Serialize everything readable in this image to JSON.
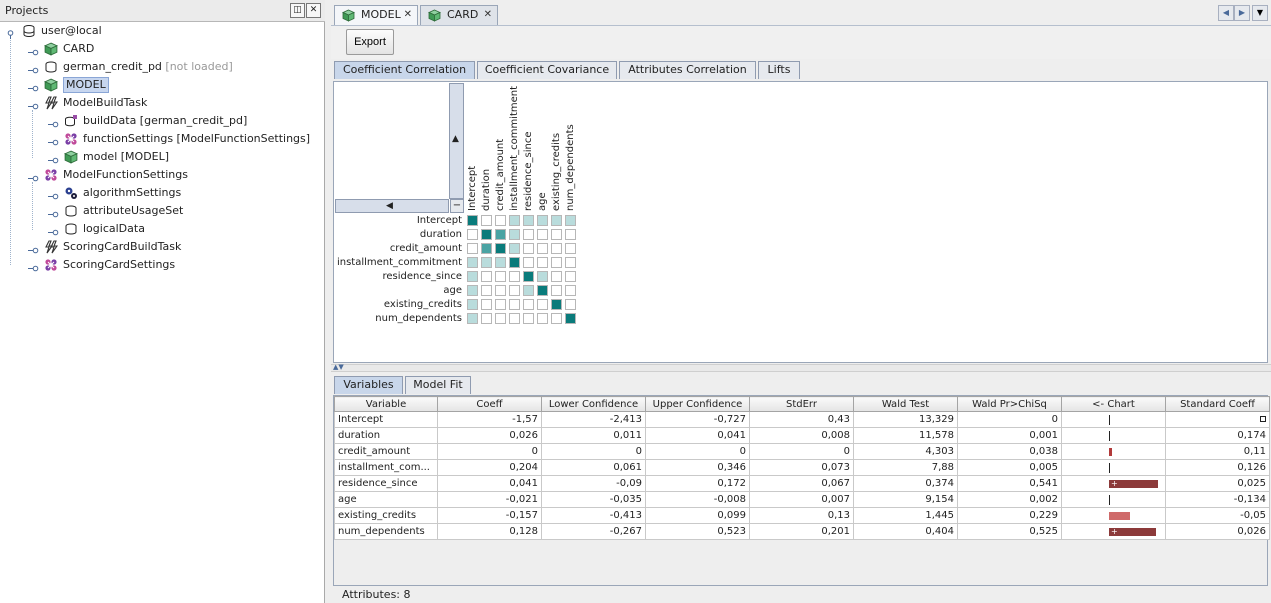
{
  "projects_panel": {
    "title": "Projects",
    "tree": [
      {
        "label": "user@local",
        "note": "",
        "icon": "database-icon",
        "level": 0
      },
      {
        "label": "CARD",
        "note": "",
        "icon": "model-cube-icon",
        "level": 1
      },
      {
        "label": "german_credit_pd",
        "note": "[not loaded]",
        "icon": "data-source-icon",
        "level": 1
      },
      {
        "label": "MODEL",
        "note": "",
        "icon": "model-cube-icon",
        "level": 1,
        "selected": true
      },
      {
        "label": "ModelBuildTask",
        "note": "",
        "icon": "build-task-icon",
        "level": 1
      },
      {
        "label": "buildData [german_credit_pd]",
        "note": "",
        "icon": "build-data-icon",
        "level": 2
      },
      {
        "label": "functionSettings [ModelFunctionSettings]",
        "note": "",
        "icon": "function-settings-icon",
        "level": 2
      },
      {
        "label": "model [MODEL]",
        "note": "",
        "icon": "model-cube-icon",
        "level": 2
      },
      {
        "label": "ModelFunctionSettings",
        "note": "",
        "icon": "function-settings-icon",
        "level": 1
      },
      {
        "label": "algorithmSettings",
        "note": "",
        "icon": "algorithm-gears-icon",
        "level": 2
      },
      {
        "label": "attributeUsageSet",
        "note": "",
        "icon": "attribute-set-icon",
        "level": 2
      },
      {
        "label": "logicalData",
        "note": "",
        "icon": "logical-data-icon",
        "level": 2
      },
      {
        "label": "ScoringCardBuildTask",
        "note": "",
        "icon": "build-task-icon",
        "level": 1
      },
      {
        "label": "ScoringCardSettings",
        "note": "",
        "icon": "function-settings-icon",
        "level": 1
      }
    ]
  },
  "doc_tabs": [
    {
      "label": "MODEL",
      "active": true
    },
    {
      "label": "CARD",
      "active": false
    }
  ],
  "toolbar": {
    "export_label": "Export"
  },
  "view_tabs": [
    {
      "label": "Coefficient Correlation",
      "active": true
    },
    {
      "label": "Coefficient Covariance",
      "active": false
    },
    {
      "label": "Attributes Correlation",
      "active": false
    },
    {
      "label": "Lifts",
      "active": false
    }
  ],
  "correlation": {
    "variables": [
      "Intercept",
      "duration",
      "credit_amount",
      "installment_commitment",
      "residence_since",
      "age",
      "existing_credits",
      "num_dependents"
    ],
    "shade": [
      [
        3,
        0,
        0,
        1,
        1,
        1,
        1,
        1
      ],
      [
        0,
        3,
        2,
        1,
        0,
        0,
        0,
        0
      ],
      [
        0,
        2,
        3,
        1,
        0,
        0,
        0,
        0
      ],
      [
        1,
        1,
        1,
        3,
        0,
        0,
        0,
        0
      ],
      [
        1,
        0,
        0,
        0,
        3,
        1,
        0,
        0
      ],
      [
        1,
        0,
        0,
        0,
        1,
        3,
        0,
        0
      ],
      [
        1,
        0,
        0,
        0,
        0,
        0,
        3,
        0
      ],
      [
        1,
        0,
        0,
        0,
        0,
        0,
        0,
        3
      ]
    ],
    "colors": [
      "#ffffff",
      "#b9dcdc",
      "#4aa3a3",
      "#0a7b7b"
    ]
  },
  "bottom_tabs": [
    {
      "label": "Variables",
      "active": true
    },
    {
      "label": "Model Fit",
      "active": false
    }
  ],
  "table": {
    "columns": [
      "Variable",
      "Coeff",
      "Lower Confidence",
      "Upper Confidence",
      "StdErr",
      "Wald Test",
      "Wald Pr>ChiSq",
      "<- Chart",
      "Standard Coeff"
    ],
    "rows": [
      {
        "variable": "Intercept",
        "coeff": "-1,57",
        "lower": "-2,413",
        "upper": "-0,727",
        "stderr": "0,43",
        "wald": "13,329",
        "pr": "0",
        "std": "",
        "bar": {
          "kind": "tick",
          "frac": 0.0
        }
      },
      {
        "variable": "duration",
        "coeff": "0,026",
        "lower": "0,011",
        "upper": "0,041",
        "stderr": "0,008",
        "wald": "11,578",
        "pr": "0,001",
        "std": "0,174",
        "bar": {
          "kind": "tick",
          "frac": 0.001
        }
      },
      {
        "variable": "credit_amount",
        "coeff": "0",
        "lower": "0",
        "upper": "0",
        "stderr": "0",
        "wald": "4,303",
        "pr": "0,038",
        "std": "0,11",
        "bar": {
          "kind": "bar",
          "frac": 0.038
        }
      },
      {
        "variable": "installment_com...",
        "coeff": "0,204",
        "lower": "0,061",
        "upper": "0,346",
        "stderr": "0,073",
        "wald": "7,88",
        "pr": "0,005",
        "std": "0,126",
        "bar": {
          "kind": "tick",
          "frac": 0.005
        }
      },
      {
        "variable": "residence_since",
        "coeff": "0,041",
        "lower": "-0,09",
        "upper": "0,172",
        "stderr": "0,067",
        "wald": "0,374",
        "pr": "0,541",
        "std": "0,025",
        "bar": {
          "kind": "bar-plus",
          "frac": 0.541
        }
      },
      {
        "variable": "age",
        "coeff": "-0,021",
        "lower": "-0,035",
        "upper": "-0,008",
        "stderr": "0,007",
        "wald": "9,154",
        "pr": "0,002",
        "std": "-0,134",
        "bar": {
          "kind": "tick",
          "frac": 0.002
        }
      },
      {
        "variable": "existing_credits",
        "coeff": "-0,157",
        "lower": "-0,413",
        "upper": "0,099",
        "stderr": "0,13",
        "wald": "1,445",
        "pr": "0,229",
        "std": "-0,05",
        "bar": {
          "kind": "bar",
          "frac": 0.229
        }
      },
      {
        "variable": "num_dependents",
        "coeff": "0,128",
        "lower": "-0,267",
        "upper": "0,523",
        "stderr": "0,201",
        "wald": "0,404",
        "pr": "0,525",
        "std": "0,026",
        "bar": {
          "kind": "bar-plus",
          "frac": 0.525
        }
      }
    ]
  },
  "status": {
    "text": "Attributes: 8"
  }
}
